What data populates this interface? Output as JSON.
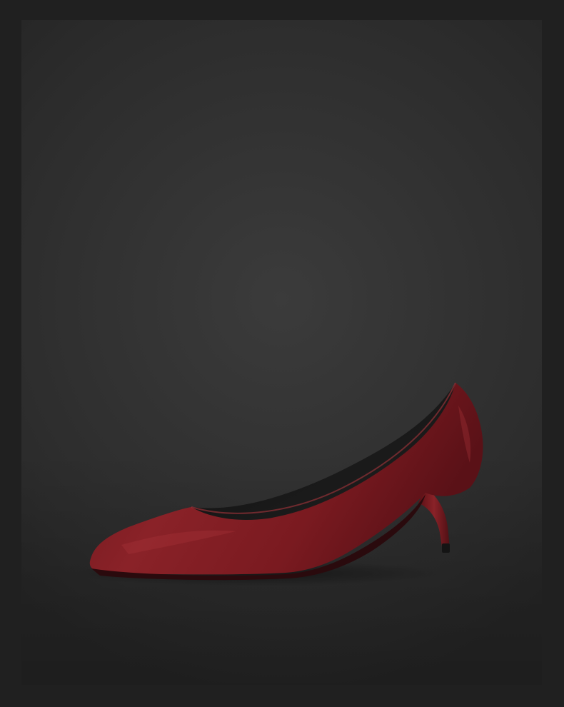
{
  "colors": {
    "frame": "#202020",
    "backdrop": "#323232",
    "shoe_leather": "#7a1a20",
    "shoe_highlight": "#9a2a30",
    "shoe_shadow": "#4e0f14",
    "lining": "#141414"
  },
  "subject": {
    "icon": "pointed-toe-pump-shoe"
  }
}
